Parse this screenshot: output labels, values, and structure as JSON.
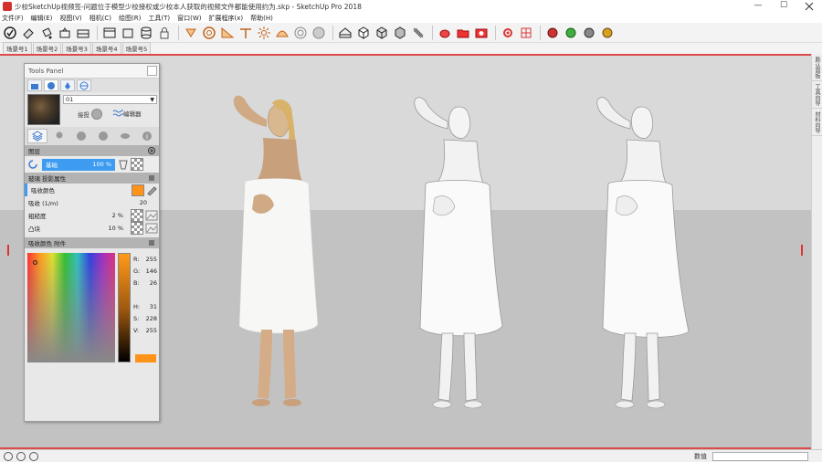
{
  "window": {
    "title": "少校SketchUp视频签-问题位于模型少校接权或少校本人获取的视频文件都能使用约为.skp - SketchUp Pro 2018",
    "minimize": "—",
    "maximize": "☐",
    "close": ""
  },
  "menu": [
    "文件(F)",
    "编辑(E)",
    "视图(V)",
    "相机(C)",
    "绘图(R)",
    "工具(T)",
    "窗口(W)",
    "扩展程序(x)",
    "帮助(H)"
  ],
  "scene_tabs": [
    "场景号1",
    "场景号2",
    "场景号3",
    "场景号4",
    "场景号5"
  ],
  "tools_panel": {
    "title": "Tools Panel",
    "material_name": "01",
    "option_1": "接投",
    "option_2": "编辑器",
    "layer_section": "图层",
    "layer_name": "基础",
    "layer_opacity": "100 %",
    "props_section": "玻璃 投影属性",
    "props": [
      {
        "label": "吸收颜色",
        "value": ""
      },
      {
        "label": "吸收 (1/m)",
        "value": "20"
      },
      {
        "label": "粗糙度",
        "value": "2 %"
      },
      {
        "label": "凸块",
        "value": "10 %"
      }
    ],
    "color_section": "吸收颜色 附件",
    "rgb": [
      {
        "k": "R:",
        "v": "255"
      },
      {
        "k": "G:",
        "v": "146"
      },
      {
        "k": "B:",
        "v": "26"
      },
      {
        "k": "",
        "v": ""
      },
      {
        "k": "H:",
        "v": "31"
      },
      {
        "k": "S:",
        "v": "228"
      },
      {
        "k": "V:",
        "v": "255"
      }
    ],
    "swatch_color": "#ff9218"
  },
  "right_tray": [
    "默认面板",
    "工具向导",
    "材料向导"
  ],
  "statusbar": {
    "measure_label": "数值",
    "measure_value": ""
  },
  "colors": {
    "sky": "#d9d9d9",
    "ground": "#c2c2c2",
    "accent": "#3d9bf0",
    "frame": "#dd4a4a"
  }
}
